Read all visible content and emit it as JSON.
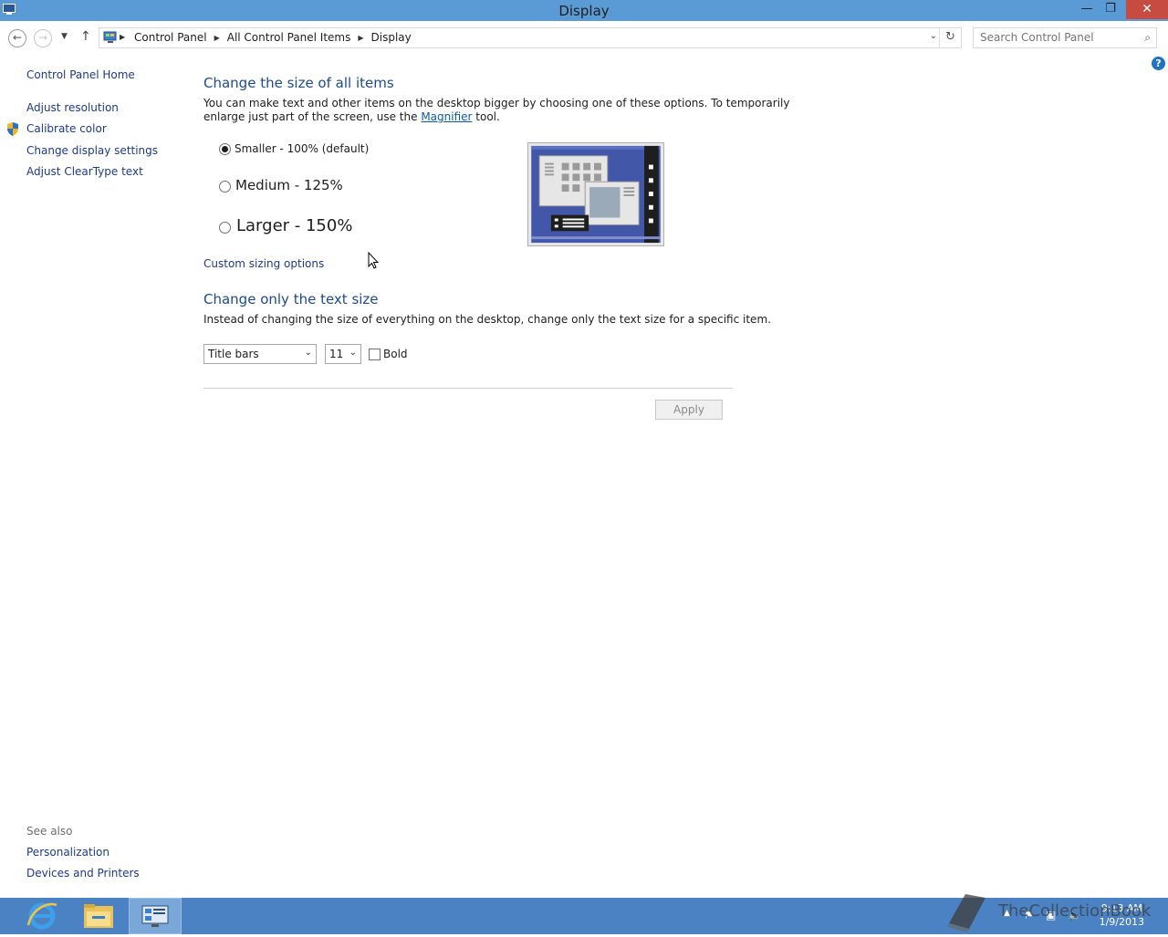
{
  "window": {
    "title": "Display",
    "minimize_glyph": "—",
    "restore_glyph": "❐",
    "close_glyph": "✕"
  },
  "nav": {
    "back_icon": "back-arrow-icon",
    "forward_icon": "forward-arrow-icon",
    "recent_icon": "chevron-down-icon",
    "up_icon": "up-arrow-icon",
    "breadcrumbs": [
      "Control Panel",
      "All Control Panel Items",
      "Display"
    ],
    "search_placeholder": "Search Control Panel"
  },
  "sidebar": {
    "home": "Control Panel Home",
    "items": [
      {
        "label": "Adjust resolution"
      },
      {
        "label": "Calibrate color",
        "icon": "shield-icon"
      },
      {
        "label": "Change display settings"
      },
      {
        "label": "Adjust ClearType text"
      }
    ],
    "see_also_heading": "See also",
    "see_also": [
      {
        "label": "Personalization"
      },
      {
        "label": "Devices and Printers"
      }
    ]
  },
  "main": {
    "size_heading": "Change the size of all items",
    "size_desc_1": "You can make text and other items on the desktop bigger by choosing one of these options. To temporarily",
    "size_desc_2a": "enlarge just part of the screen, use the ",
    "magnifier_link": "Magnifier",
    "size_desc_2b": " tool.",
    "options": [
      {
        "label": "Smaller - 100% (default)",
        "checked": true
      },
      {
        "label": "Medium - 125%",
        "checked": false
      },
      {
        "label": "Larger - 150%",
        "checked": false
      }
    ],
    "custom_link": "Custom sizing options",
    "text_heading": "Change only the text size",
    "text_desc": "Instead of changing the size of everything on the desktop, change only the text size for a specific item.",
    "item_select": "Title bars",
    "size_select": "11",
    "bold_label": "Bold",
    "bold_checked": false,
    "apply_label": "Apply"
  },
  "taskbar": {
    "apps": [
      {
        "name": "Internet Explorer",
        "icon": "ie-icon"
      },
      {
        "name": "File Explorer",
        "icon": "folder-icon"
      },
      {
        "name": "Control Panel",
        "icon": "control-panel-icon",
        "active": true
      }
    ],
    "time": "9:13 AM",
    "date": "1/9/2013"
  },
  "watermark": {
    "text": "TheCollectionBook"
  },
  "colors": {
    "titlebar": "#5b9bd5",
    "taskbar": "#4a82c4",
    "heading": "#1e4b8c",
    "link": "#1e3a8a",
    "close": "#c74b40"
  }
}
